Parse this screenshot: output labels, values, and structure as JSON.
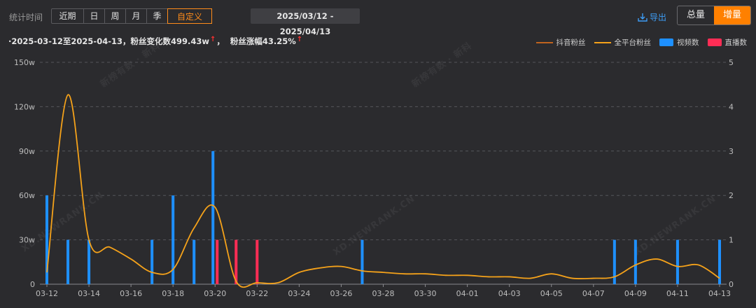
{
  "toolbar": {
    "label": "统计时间",
    "periods": [
      "近期",
      "日",
      "周",
      "月",
      "季",
      "自定义"
    ],
    "active_period": "自定义",
    "date_range": "2025/03/12  -  2025/04/13",
    "export_label": "导出",
    "toggle": [
      "总量",
      "增量"
    ],
    "active_toggle": "增量"
  },
  "summary": {
    "part1": "·2025-03-12至2025-04-13，粉丝变化数499.43w",
    "part2": "粉丝涨幅43.25%",
    "arrow": "↑"
  },
  "legend": [
    {
      "name": "抖音粉丝",
      "kind": "line",
      "color": "#c0641e"
    },
    {
      "name": "全平台粉丝",
      "kind": "line",
      "color": "#f5a21a"
    },
    {
      "name": "视频数",
      "kind": "bar",
      "color": "#1e90ff"
    },
    {
      "name": "直播数",
      "kind": "bar",
      "color": "#ff2d55"
    }
  ],
  "watermarks": [
    "新榜有数 · 新科",
    "XD.NEWRANK.CN",
    "XD.NEWRANK.CN",
    "XD.NEWRANK.CN",
    "新榜有数 · 新科"
  ],
  "chart_data": {
    "type": "bar",
    "x_ticks": [
      "03-12",
      "03-14",
      "03-16",
      "03-18",
      "03-20",
      "03-22",
      "03-24",
      "03-26",
      "03-28",
      "03-30",
      "04-01",
      "04-03",
      "04-05",
      "04-07",
      "04-09",
      "04-11",
      "04-13"
    ],
    "y_left_ticks": [
      "0",
      "30w",
      "60w",
      "90w",
      "120w",
      "150w"
    ],
    "y_left_range": [
      0,
      150
    ],
    "y_right_ticks": [
      "0",
      "1",
      "2",
      "3",
      "4",
      "5"
    ],
    "y_right_range": [
      0,
      5
    ],
    "grid": true,
    "days": [
      "03-12",
      "03-13",
      "03-14",
      "03-15",
      "03-16",
      "03-17",
      "03-18",
      "03-19",
      "03-20",
      "03-21",
      "03-22",
      "03-23",
      "03-24",
      "03-25",
      "03-26",
      "03-27",
      "03-28",
      "03-29",
      "03-30",
      "03-31",
      "04-01",
      "04-02",
      "04-03",
      "04-04",
      "04-05",
      "04-06",
      "04-07",
      "04-08",
      "04-09",
      "04-10",
      "04-11",
      "04-12",
      "04-13"
    ],
    "series": [
      {
        "name": "全平台粉丝",
        "axis": "left",
        "kind": "line",
        "color": "#f5a21a",
        "values": [
          8,
          128,
          30,
          25,
          17,
          8,
          10,
          38,
          52,
          2,
          1,
          1,
          8,
          11,
          12,
          9,
          8,
          7,
          7,
          6,
          6,
          5,
          5,
          4,
          7,
          4,
          4,
          5,
          13,
          17,
          12,
          13,
          4
        ]
      },
      {
        "name": "视频数",
        "axis": "right",
        "kind": "bar",
        "color": "#1e90ff",
        "values": [
          2,
          1,
          1,
          0,
          0,
          1,
          2,
          1,
          3,
          0,
          0,
          0,
          0,
          0,
          0,
          1,
          0,
          0,
          0,
          0,
          0,
          0,
          0,
          0,
          0,
          0,
          0,
          1,
          1,
          0,
          1,
          0,
          1
        ]
      },
      {
        "name": "直播数",
        "axis": "right",
        "kind": "bar",
        "color": "#ff2d55",
        "values": [
          0,
          0,
          0,
          0,
          0,
          0,
          0,
          0,
          1,
          1,
          1,
          0,
          0,
          0,
          0,
          0,
          0,
          0,
          0,
          0,
          0,
          0,
          0,
          0,
          0,
          0,
          0,
          0,
          0,
          0,
          0,
          0,
          0
        ]
      }
    ]
  }
}
